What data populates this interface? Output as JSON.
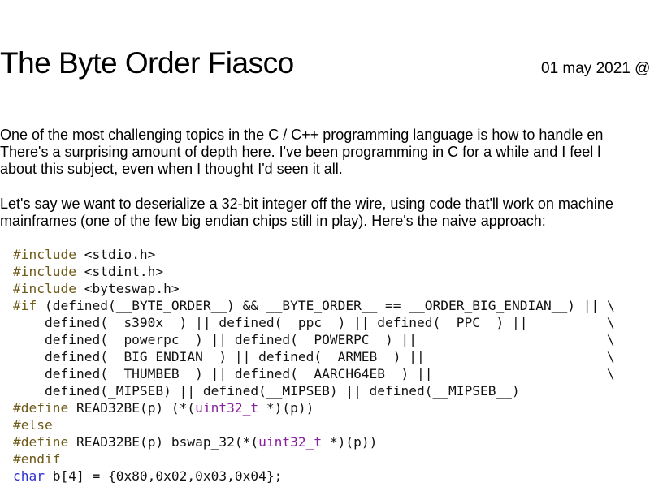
{
  "post": {
    "title": "The Byte Order Fiasco",
    "date": "01 may 2021 @"
  },
  "paragraphs": [
    {
      "lines": [
        "One of the most challenging topics in the C / C++ programming language is how to handle en",
        "There's a surprising amount of depth here. I've been programming in C for a while and I feel l",
        "about this subject, even when I thought I'd seen it all."
      ]
    },
    {
      "lines": [
        "Let's say we want to deserialize a 32-bit integer off the wire, using code that'll work on machine",
        "mainframes (one of the few big endian chips still in play). Here's the naive approach:"
      ]
    }
  ],
  "code": {
    "lines": [
      [
        {
          "t": "#include",
          "c": "preproc"
        },
        {
          "t": " <stdio.h>"
        }
      ],
      [
        {
          "t": "#include",
          "c": "preproc"
        },
        {
          "t": " <stdint.h>"
        }
      ],
      [
        {
          "t": "#include",
          "c": "preproc"
        },
        {
          "t": " <byteswap.h>"
        }
      ],
      [
        {
          "t": "#if",
          "c": "preproc"
        },
        {
          "t": " (defined(__BYTE_ORDER__) && __BYTE_ORDER__ == __ORDER_BIG_ENDIAN__) || \\"
        }
      ],
      [
        {
          "t": "    defined(__s390x__) || defined(__ppc__) || defined(__PPC__) ||          \\"
        }
      ],
      [
        {
          "t": "    defined(__powerpc__) || defined(__POWERPC__) ||                        \\"
        }
      ],
      [
        {
          "t": "    defined(__BIG_ENDIAN__) || defined(__ARMEB__) ||                       \\"
        }
      ],
      [
        {
          "t": "    defined(__THUMBEB__) || defined(__AARCH64EB__) ||                      \\"
        }
      ],
      [
        {
          "t": "    defined(_MIPSEB) || defined(__MIPSEB) || defined(__MIPSEB__)"
        }
      ],
      [
        {
          "t": "#define",
          "c": "preproc"
        },
        {
          "t": " READ32BE(p) (*("
        },
        {
          "t": "uint32_t",
          "c": "type"
        },
        {
          "t": " *)(p))"
        }
      ],
      [
        {
          "t": "#else",
          "c": "preproc"
        }
      ],
      [
        {
          "t": "#define",
          "c": "preproc"
        },
        {
          "t": " READ32BE(p) bswap_32(*("
        },
        {
          "t": "uint32_t",
          "c": "type"
        },
        {
          "t": " *)(p))"
        }
      ],
      [
        {
          "t": "#endif",
          "c": "preproc"
        }
      ],
      [
        {
          "t": "char",
          "c": "kw"
        },
        {
          "t": " b[4] = {0x80,0x02,0x03,0x04};"
        }
      ]
    ]
  }
}
